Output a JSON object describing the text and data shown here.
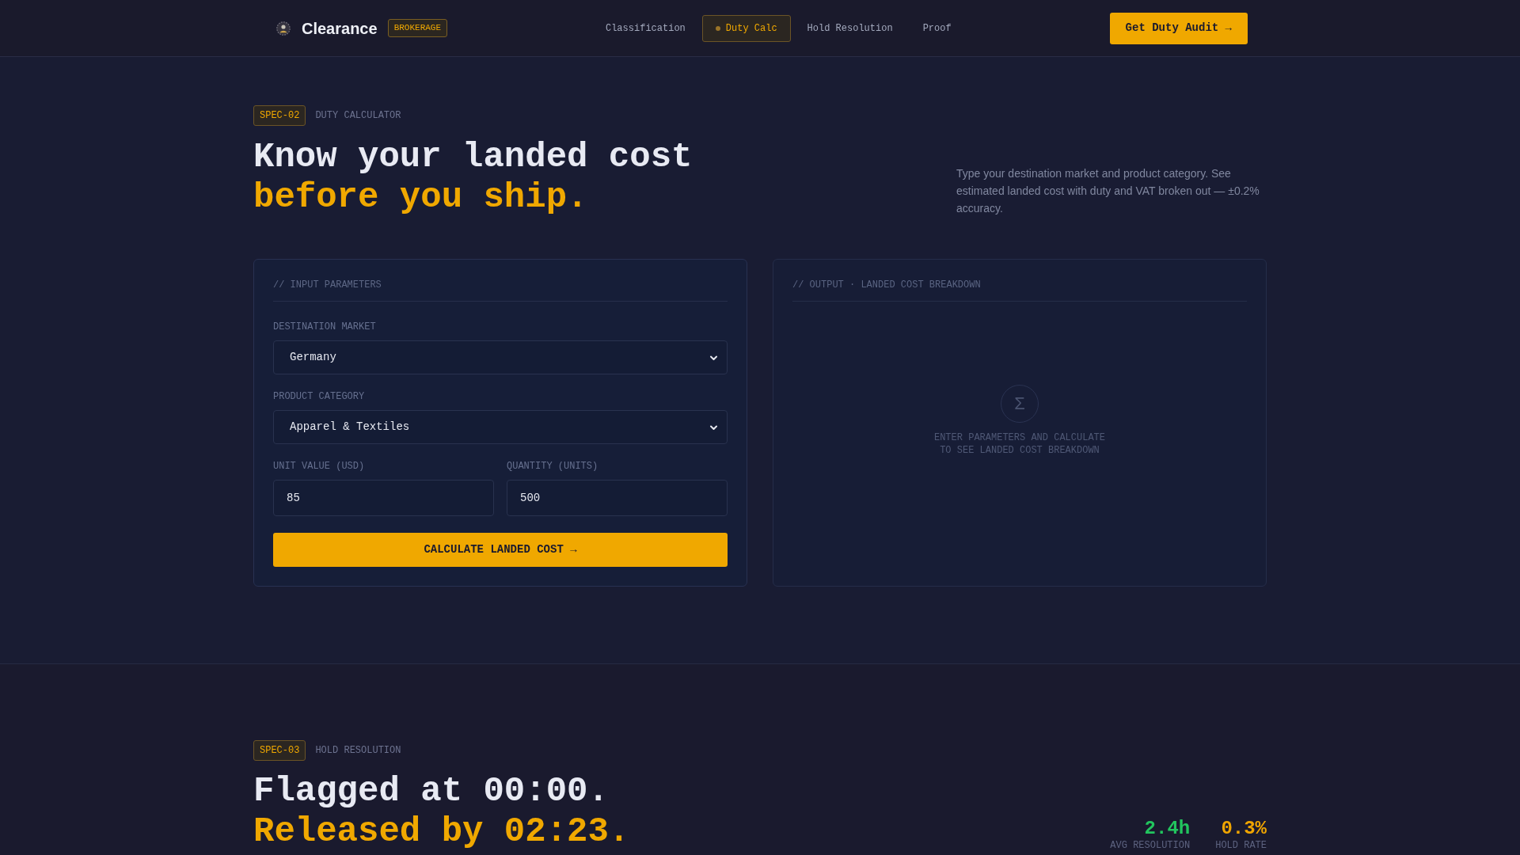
{
  "header": {
    "brand": "Clearance",
    "brand_badge": "BROKERAGE",
    "nav": [
      {
        "label": "Classification",
        "selected": false
      },
      {
        "label": "Duty Calc",
        "selected": true
      },
      {
        "label": "Hold Resolution",
        "selected": false
      },
      {
        "label": "Proof",
        "selected": false
      }
    ],
    "cta": "Get Duty Audit →"
  },
  "duty_calculator": {
    "tag": "SPEC-02",
    "eyebrow": "DUTY CALCULATOR",
    "title": "Know your landed cost",
    "title_highlight": "before you ship.",
    "description": "Type your destination market and product category. See estimated landed cost with duty and VAT broken out — ±0.2% accuracy.",
    "input_panel": {
      "heading": "// INPUT PARAMETERS",
      "fields": [
        {
          "kind": "select",
          "label": "DESTINATION MARKET",
          "value": "Germany"
        },
        {
          "kind": "select",
          "label": "PRODUCT CATEGORY",
          "value": "Apparel & Textiles"
        },
        {
          "kind": "input",
          "label": "UNIT VALUE (USD)",
          "value": "85"
        },
        {
          "kind": "input",
          "label": "QUANTITY (UNITS)",
          "value": "500"
        }
      ],
      "button": "CALCULATE LANDED COST →"
    },
    "output_panel": {
      "heading": "// OUTPUT · LANDED COST BREAKDOWN",
      "empty_icon": "Σ",
      "empty_message": "ENTER PARAMETERS AND CALCULATE TO SEE LANDED COST BREAKDOWN"
    }
  },
  "hold_resolution": {
    "tag": "SPEC-03",
    "eyebrow": "HOLD RESOLUTION",
    "title": "Flagged at 00:00.",
    "title_highlight": "Released by 02:23.",
    "stats": [
      {
        "value": "2.4h",
        "label": "AVG RESOLUTION",
        "color": "#22c55e"
      },
      {
        "value": "0.3%",
        "label": "HOLD RATE",
        "color": "#f0a500"
      }
    ]
  }
}
